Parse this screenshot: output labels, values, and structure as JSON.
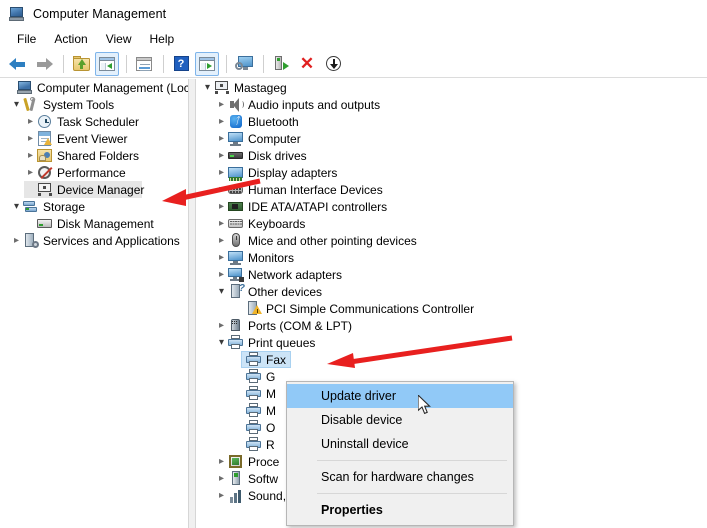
{
  "window": {
    "title": "Computer Management",
    "title_icon": "computer-management-icon"
  },
  "menubar": {
    "items": [
      {
        "label": "File"
      },
      {
        "label": "Action"
      },
      {
        "label": "View"
      },
      {
        "label": "Help"
      }
    ]
  },
  "toolbar": {
    "buttons": [
      {
        "name": "back-button",
        "icon": "back-arrow-icon"
      },
      {
        "name": "forward-button",
        "icon": "forward-arrow-icon"
      },
      {
        "name": "up-one-level-button",
        "icon": "folder-up-icon"
      },
      {
        "name": "show-hide-console-tree-button",
        "icon": "console-tree-icon"
      },
      {
        "name": "properties-button",
        "icon": "properties-window-icon"
      },
      {
        "name": "help-button",
        "icon": "help-question-icon"
      },
      {
        "name": "show-hide-action-pane-button",
        "icon": "action-pane-icon"
      },
      {
        "name": "connect-to-another-computer-button",
        "icon": "remote-computer-icon"
      },
      {
        "name": "update-driver-button",
        "icon": "device-update-icon"
      },
      {
        "name": "uninstall-device-button",
        "icon": "red-x-icon"
      },
      {
        "name": "scan-for-hardware-changes-button",
        "icon": "download-circle-icon"
      }
    ]
  },
  "tree_left": {
    "items": [
      {
        "label": "Computer Management (Local",
        "icon": "computer-management-icon",
        "indent": 0,
        "chevron": "none",
        "selected": false
      },
      {
        "label": "System Tools",
        "icon": "system-tools-icon",
        "indent": 1,
        "chevron": "open",
        "selected": false
      },
      {
        "label": "Task Scheduler",
        "icon": "task-scheduler-icon",
        "indent": 2,
        "chevron": "closed",
        "selected": false
      },
      {
        "label": "Event Viewer",
        "icon": "event-viewer-icon",
        "indent": 2,
        "chevron": "closed",
        "selected": false
      },
      {
        "label": "Shared Folders",
        "icon": "shared-folders-icon",
        "indent": 2,
        "chevron": "closed",
        "selected": false
      },
      {
        "label": "Performance",
        "icon": "performance-icon",
        "indent": 2,
        "chevron": "closed",
        "selected": false
      },
      {
        "label": "Device Manager",
        "icon": "device-manager-icon",
        "indent": 2,
        "chevron": "none",
        "selected": true
      },
      {
        "label": "Storage",
        "icon": "storage-icon",
        "indent": 1,
        "chevron": "open",
        "selected": false
      },
      {
        "label": "Disk Management",
        "icon": "disk-management-icon",
        "indent": 2,
        "chevron": "none",
        "selected": false
      },
      {
        "label": "Services and Applications",
        "icon": "services-applications-icon",
        "indent": 1,
        "chevron": "closed",
        "selected": false
      }
    ]
  },
  "tree_right": {
    "items": [
      {
        "label": "Mastageg",
        "icon": "computer-node-icon",
        "indent": 0,
        "chevron": "open",
        "selected": false
      },
      {
        "label": "Audio inputs and outputs",
        "icon": "audio-icon",
        "indent": 1,
        "chevron": "closed",
        "selected": false
      },
      {
        "label": "Bluetooth",
        "icon": "bluetooth-icon",
        "indent": 1,
        "chevron": "closed",
        "selected": false
      },
      {
        "label": "Computer",
        "icon": "computer-icon",
        "indent": 1,
        "chevron": "closed",
        "selected": false
      },
      {
        "label": "Disk drives",
        "icon": "disk-drive-icon",
        "indent": 1,
        "chevron": "closed",
        "selected": false
      },
      {
        "label": "Display adapters",
        "icon": "display-adapter-icon",
        "indent": 1,
        "chevron": "closed",
        "selected": false
      },
      {
        "label": "Human Interface Devices",
        "icon": "human-interface-device-icon",
        "indent": 1,
        "chevron": "closed",
        "selected": false
      },
      {
        "label": "IDE ATA/ATAPI controllers",
        "icon": "ide-controller-icon",
        "indent": 1,
        "chevron": "closed",
        "selected": false
      },
      {
        "label": "Keyboards",
        "icon": "keyboard-icon",
        "indent": 1,
        "chevron": "closed",
        "selected": false
      },
      {
        "label": "Mice and other pointing devices",
        "icon": "mouse-icon",
        "indent": 1,
        "chevron": "closed",
        "selected": false
      },
      {
        "label": "Monitors",
        "icon": "monitor-icon",
        "indent": 1,
        "chevron": "closed",
        "selected": false
      },
      {
        "label": "Network adapters",
        "icon": "network-adapter-icon",
        "indent": 1,
        "chevron": "closed",
        "selected": false
      },
      {
        "label": "Other devices",
        "icon": "other-devices-icon",
        "indent": 1,
        "chevron": "open",
        "selected": false
      },
      {
        "label": "PCI Simple Communications Controller",
        "icon": "pci-device-warning-icon",
        "indent": 2,
        "chevron": "none",
        "selected": false
      },
      {
        "label": "Ports (COM & LPT)",
        "icon": "port-icon",
        "indent": 1,
        "chevron": "closed",
        "selected": false
      },
      {
        "label": "Print queues",
        "icon": "printer-icon",
        "indent": 1,
        "chevron": "open",
        "selected": false
      },
      {
        "label": "Fax",
        "icon": "printer-icon",
        "indent": 2,
        "chevron": "none",
        "selected": true
      },
      {
        "label": "G",
        "icon": "printer-icon",
        "indent": 2,
        "chevron": "none",
        "selected": false
      },
      {
        "label": "M",
        "icon": "printer-icon",
        "indent": 2,
        "chevron": "none",
        "selected": false
      },
      {
        "label": "M",
        "icon": "printer-icon",
        "indent": 2,
        "chevron": "none",
        "selected": false
      },
      {
        "label": "O",
        "icon": "printer-icon",
        "indent": 2,
        "chevron": "none",
        "selected": false
      },
      {
        "label": "R",
        "icon": "printer-icon",
        "indent": 2,
        "chevron": "none",
        "selected": false
      },
      {
        "label": "Proce",
        "icon": "processor-icon",
        "indent": 1,
        "chevron": "closed",
        "selected": false
      },
      {
        "label": "Softw",
        "icon": "software-device-icon",
        "indent": 1,
        "chevron": "closed",
        "selected": false
      },
      {
        "label": "Sound, video and game controllers",
        "icon": "sound-video-icon",
        "indent": 1,
        "chevron": "closed",
        "selected": false
      }
    ]
  },
  "context_menu": {
    "items": [
      {
        "label": "Update driver",
        "type": "item",
        "highlight": true,
        "bold": false
      },
      {
        "label": "Disable device",
        "type": "item",
        "highlight": false,
        "bold": false
      },
      {
        "label": "Uninstall device",
        "type": "item",
        "highlight": false,
        "bold": false
      },
      {
        "label": "",
        "type": "separator",
        "highlight": false,
        "bold": false
      },
      {
        "label": "Scan for hardware changes",
        "type": "item",
        "highlight": false,
        "bold": false
      },
      {
        "label": "",
        "type": "separator",
        "highlight": false,
        "bold": false
      },
      {
        "label": "Properties",
        "type": "item",
        "highlight": false,
        "bold": true
      }
    ]
  },
  "annotations": {
    "arrow_color": "#e8201f",
    "arrows": [
      {
        "name": "arrow-to-device-manager",
        "points_to": "Device Manager"
      },
      {
        "name": "arrow-to-print-queues",
        "points_to": "Print queues"
      }
    ]
  },
  "colors": {
    "selection_blue": "#cce4f7",
    "menu_highlight": "#91c9f7",
    "selection_gray": "#e6e6e6",
    "window_bg": "#ffffff"
  }
}
